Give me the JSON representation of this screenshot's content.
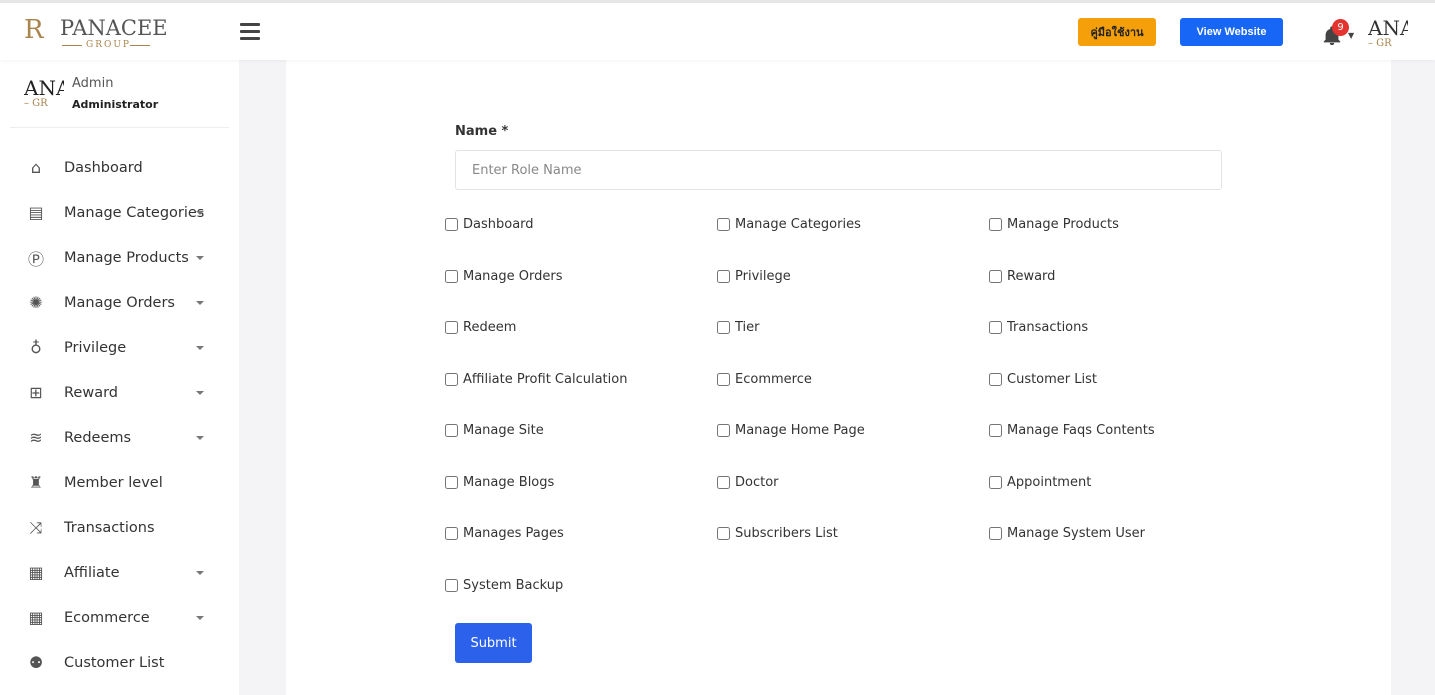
{
  "header": {
    "logo": {
      "monogram": "R",
      "brand": "PANACEE",
      "sub": "GROUP"
    },
    "guide_button": "คู่มือใช้งาน",
    "view_website_button": "View Website",
    "notification_count": "9",
    "avatar": {
      "line1": "ANA",
      "line2": "– GR"
    }
  },
  "sidebar": {
    "profile": {
      "avatar_line1": "ANA",
      "avatar_line2": "– GR",
      "name": "Admin",
      "role": "Administrator"
    },
    "items": [
      {
        "label": "Dashboard",
        "icon": "home-icon",
        "glyph": "⌂",
        "caret": false
      },
      {
        "label": "Manage Categories",
        "icon": "list-icon",
        "glyph": "▤",
        "caret": true
      },
      {
        "label": "Manage Products",
        "icon": "product-p-icon",
        "glyph": "Ⓟ",
        "caret": true
      },
      {
        "label": "Manage Orders",
        "icon": "orders-icon",
        "glyph": "✺",
        "caret": true
      },
      {
        "label": "Privilege",
        "icon": "award-icon",
        "glyph": "♁",
        "caret": true
      },
      {
        "label": "Reward",
        "icon": "gift-icon",
        "glyph": "⊞",
        "caret": true
      },
      {
        "label": "Redeems",
        "icon": "layers-icon",
        "glyph": "≋",
        "caret": true
      },
      {
        "label": "Member level",
        "icon": "trophy-icon",
        "glyph": "♜",
        "caret": false
      },
      {
        "label": "Transactions",
        "icon": "shuffle-icon",
        "glyph": "⤨",
        "caret": false
      },
      {
        "label": "Affiliate",
        "icon": "table-icon",
        "glyph": "▦",
        "caret": true
      },
      {
        "label": "Ecommerce",
        "icon": "table-icon",
        "glyph": "▦",
        "caret": true
      },
      {
        "label": "Customer List",
        "icon": "users-icon",
        "glyph": "⚉",
        "caret": false
      }
    ]
  },
  "form": {
    "name_label": "Name *",
    "name_placeholder": "Enter Role Name",
    "name_value": "",
    "permissions": [
      "Dashboard",
      "Manage Categories",
      "Manage Products",
      "Manage Orders",
      "Privilege",
      "Reward",
      "Redeem",
      "Tier",
      "Transactions",
      "Affiliate Profit Calculation",
      "Ecommerce",
      "Customer List",
      "Manage Site",
      "Manage Home Page",
      "Manage Faqs Contents",
      "Manage Blogs",
      "Doctor",
      "Appointment",
      "Manages Pages",
      "Subscribers List",
      "Manage System User",
      "System Backup"
    ],
    "submit_label": "Submit"
  },
  "colors": {
    "guide_button": "#f5a00a",
    "view_button": "#1766f5",
    "submit_button": "#2c61ec",
    "badge": "#e3342f",
    "logo_gold": "#a9844c"
  }
}
